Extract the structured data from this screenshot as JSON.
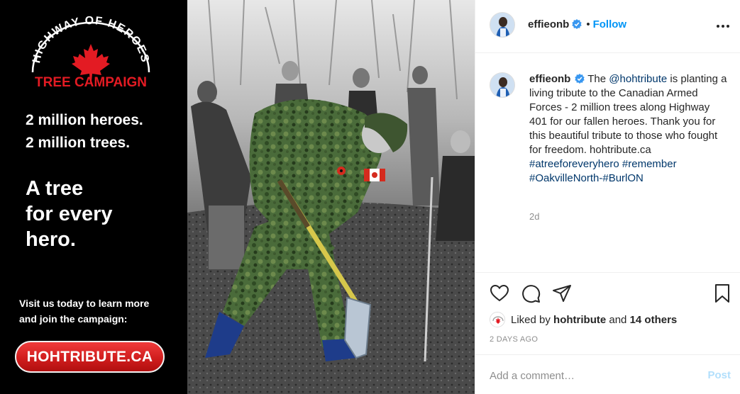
{
  "ad": {
    "arc_text": "HIGHWAY OF HEROES",
    "campaign_text": "TREE CAMPAIGN",
    "line1": "2 million heroes.",
    "line2": "2 million trees.",
    "big1": "A tree",
    "big2": "for every",
    "big3": "hero.",
    "visit1": "Visit us today to learn more",
    "visit2": "and join the campaign:",
    "url_button": "HOHTRIBUTE.CA",
    "colors": {
      "brand_red": "#e31b23",
      "background": "#000000"
    }
  },
  "photo": {
    "icon": "soldier-planting-tree-photo"
  },
  "header": {
    "username": "effieonb",
    "verified_icon": "verified-badge-icon",
    "separator": "•",
    "follow_label": "Follow",
    "more_icon": "more-options-icon"
  },
  "caption": {
    "username": "effieonb",
    "text_before": "The",
    "mention": "@hohtribute",
    "text_after": "is planting a living tribute to the Canadian Armed Forces - 2 million trees along Highway 401 for our fallen heroes. Thank you for this beautiful tribute to those who fought for freedom. hohtribute.ca",
    "hashtags_line1": "#atreeforeveryhero #remember",
    "hashtags_line2": "#OakvilleNorth-#BurlON",
    "time_ago": "2d"
  },
  "actions": {
    "like_icon": "heart-icon",
    "comment_icon": "comment-icon",
    "share_icon": "paper-plane-icon",
    "save_icon": "bookmark-icon"
  },
  "likes": {
    "prefix": "Liked by",
    "user": "hohtribute",
    "conj": "and",
    "others": "14 others"
  },
  "date": "2 DAYS AGO",
  "comment": {
    "placeholder": "Add a comment…",
    "post_label": "Post"
  },
  "colors": {
    "link": "#00376b",
    "follow": "#0095f6",
    "post_disabled": "#b2dffc",
    "meta": "#8e8e8e",
    "verified": "#3897f0"
  }
}
